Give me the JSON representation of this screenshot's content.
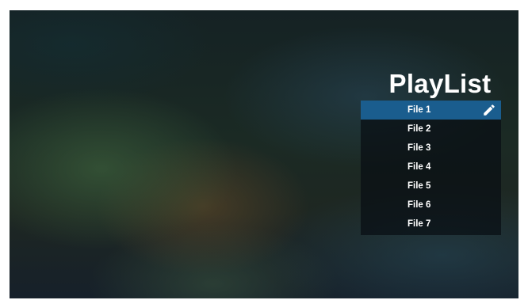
{
  "playlist": {
    "title": "PlayList",
    "files": [
      {
        "label": "File 1",
        "selected": true
      },
      {
        "label": "File 2",
        "selected": false
      },
      {
        "label": "File 3",
        "selected": false
      },
      {
        "label": "File 4",
        "selected": false
      },
      {
        "label": "File 5",
        "selected": false
      },
      {
        "label": "File 6",
        "selected": false
      },
      {
        "label": "File 7",
        "selected": false
      }
    ],
    "edit_icon": "pencil-icon"
  },
  "colors": {
    "selected_row": "#1a5d8e",
    "list_background": "#080e14",
    "text": "#ffffff"
  }
}
